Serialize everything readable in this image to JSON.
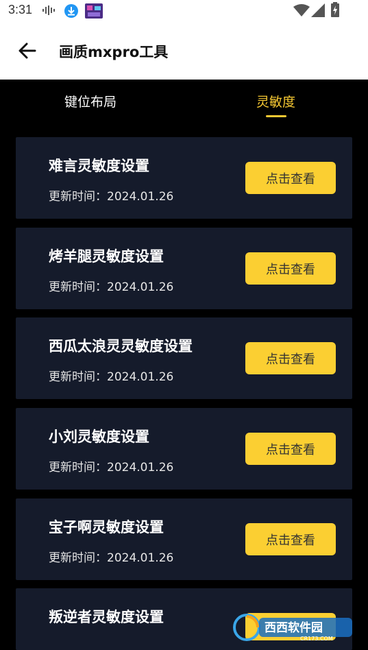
{
  "status_bar": {
    "time": "3:31"
  },
  "app_bar": {
    "title": "画质mxpro工具"
  },
  "tabs": [
    {
      "label": "键位布局",
      "active": false
    },
    {
      "label": "灵敏度",
      "active": true
    }
  ],
  "colors": {
    "accent": "#fbcf32",
    "card_bg": "#151b2b",
    "page_bg": "#000000"
  },
  "items": [
    {
      "title": "难言灵敏度设置",
      "date": "更新时间：2024.01.26",
      "button": "点击查看"
    },
    {
      "title": "烤羊腿灵敏度设置",
      "date": "更新时间：2024.01.26",
      "button": "点击查看"
    },
    {
      "title": "西瓜太浪灵灵敏度设置",
      "date": "更新时间：2024.01.26",
      "button": "点击查看"
    },
    {
      "title": "小刘灵敏度设置",
      "date": "更新时间：2024.01.26",
      "button": "点击查看"
    },
    {
      "title": "宝子啊灵敏度设置",
      "date": "更新时间：2024.01.26",
      "button": "点击查看"
    },
    {
      "title": "叛逆者灵敏度设置",
      "date": "",
      "button": ""
    }
  ],
  "watermark": {
    "text": "西西软件园",
    "sub": "CR173.COM"
  }
}
